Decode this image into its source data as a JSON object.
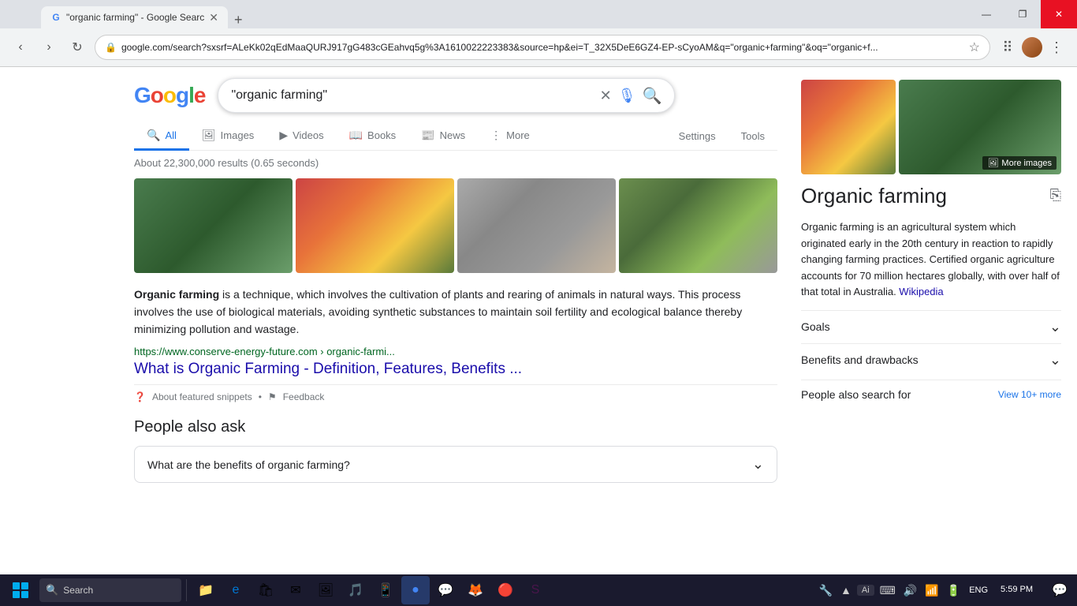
{
  "browser": {
    "tab": {
      "title": "\"organic farming\" - Google Searc",
      "favicon": "G"
    },
    "address": "google.com/search?sxsrf=ALeKk02qEdMaaQURJ917gG483cGEahvq5g%3A1610022223383&source=hp&ei=T_32X5DeE6GZ4-EP-sCyoAM&q=\"organic+farming\"&oq=\"organic+f...",
    "new_tab_label": "+",
    "win_minimize": "—",
    "win_restore": "❐",
    "win_close": "✕"
  },
  "search": {
    "query": "\"organic farming\"",
    "placeholder": "Search",
    "results_info": "About 22,300,000 results (0.65 seconds)"
  },
  "tabs": [
    {
      "label": "All",
      "icon": "🔍",
      "active": true
    },
    {
      "label": "Images",
      "icon": "🖼",
      "active": false
    },
    {
      "label": "Videos",
      "icon": "▶",
      "active": false
    },
    {
      "label": "Books",
      "icon": "📖",
      "active": false
    },
    {
      "label": "News",
      "icon": "📰",
      "active": false
    },
    {
      "label": "More",
      "icon": "⋮",
      "active": false
    }
  ],
  "settings_label": "Settings",
  "tools_label": "Tools",
  "snippet": {
    "bold": "Organic farming",
    "text": " is a technique, which involves the cultivation of plants and rearing of animals in natural ways. This process involves the use of biological materials, avoiding synthetic substances to maintain soil fertility and ecological balance thereby minimizing pollution and wastage.",
    "url": "https://www.conserve-energy-future.com › organic-farmi...",
    "title": "What is Organic Farming - Definition, Features, Benefits ...",
    "about_label": "About featured snippets",
    "dot": "•",
    "feedback_label": "Feedback"
  },
  "people_also_ask": {
    "title": "People also ask",
    "question": "What are the benefits of organic farming?"
  },
  "right_panel": {
    "more_images": "More images",
    "title": "Organic farming",
    "description": "Organic farming is an agricultural system which originated early in the 20th century in reaction to rapidly changing farming practices. Certified organic agriculture accounts for 70 million hectares globally, with over half of that total in Australia.",
    "wikipedia": "Wikipedia",
    "goals_label": "Goals",
    "benefits_label": "Benefits and drawbacks",
    "people_also_search": "People also search for",
    "view_more": "View 10+ more"
  },
  "taskbar": {
    "search_placeholder": "Search",
    "ai_label": "Ai",
    "language": "ENG",
    "time": "5:59 PM",
    "notification_icon": "💬",
    "tray_icons": [
      "🔧",
      "🔊",
      "📶",
      "🔋"
    ]
  }
}
